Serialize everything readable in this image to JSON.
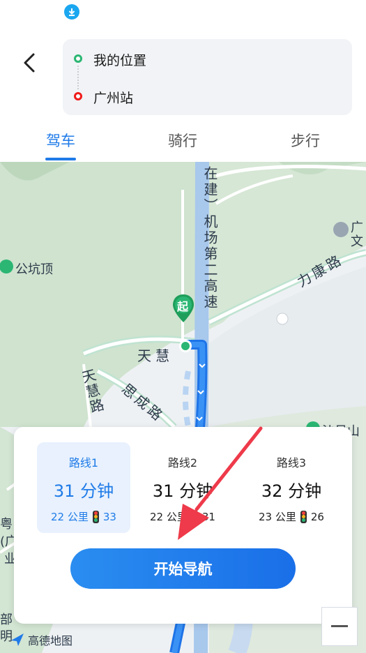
{
  "header": {
    "start_location": "我的位置",
    "end_location": "广州站"
  },
  "tabs": [
    {
      "label": "驾车",
      "active": true
    },
    {
      "label": "骑行",
      "active": false
    },
    {
      "label": "步行",
      "active": false
    }
  ],
  "map": {
    "labels": {
      "poi_gongkengding": "公坑顶",
      "road_lihang": "力康路",
      "road_tianhui_h": "天慧",
      "road_tianhui_v": "天慧路",
      "road_sicheng": "思成路",
      "road_airport": "在建）机场第二高速",
      "partial_guang": "广",
      "partial_wen": "文",
      "partial_shao": "沙贝山",
      "partial_yue": "粤",
      "partial_guang2": "(广",
      "partial_ye": "业",
      "partial_bu": "部",
      "partial_ming": "明"
    },
    "start_marker_label": "起",
    "logo_text": "高德地图"
  },
  "routes": [
    {
      "name": "路线1",
      "time": "31 分钟",
      "distance": "22 公里",
      "lights": "33",
      "selected": true
    },
    {
      "name": "路线2",
      "time": "31 分钟",
      "distance": "22 公里",
      "lights": "31",
      "selected": false
    },
    {
      "name": "路线3",
      "time": "32 分钟",
      "distance": "23 公里",
      "lights": "26",
      "selected": false
    }
  ],
  "actions": {
    "start_navigation": "开始导航"
  },
  "colors": {
    "accent": "#1f7be8",
    "route_line": "#2b7ff0",
    "start_green": "#2bb673",
    "end_red": "#f01b1b",
    "annotation_arrow": "#ee3a4a"
  }
}
